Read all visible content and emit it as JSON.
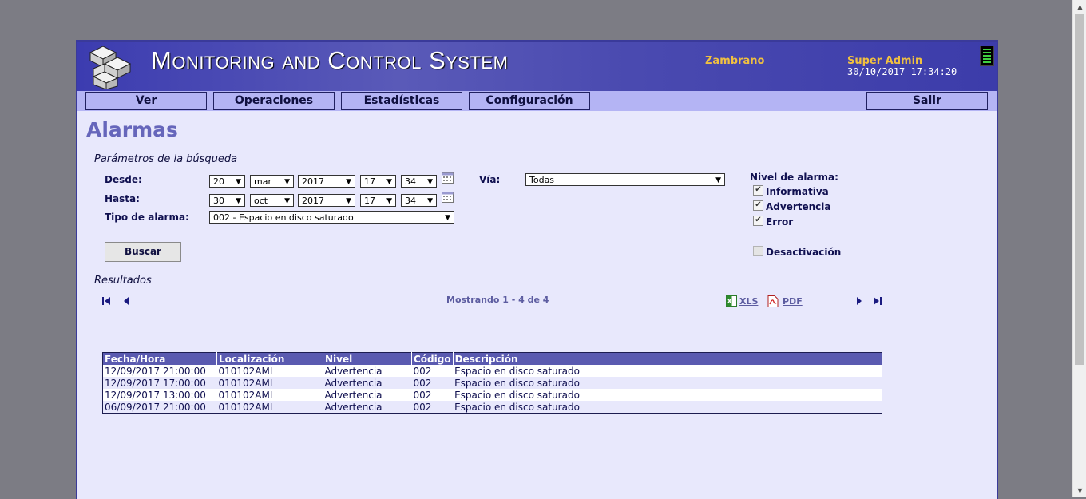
{
  "header": {
    "app_title": "Monitoring and Control System",
    "server_name": "Zambrano",
    "user_role": "Super Admin",
    "datetime": "30/10/2017 17:34:20"
  },
  "nav": {
    "items": [
      "Ver",
      "Operaciones",
      "Estadísticas",
      "Configuración"
    ],
    "logout": "Salir"
  },
  "page": {
    "title": "Alarmas"
  },
  "search": {
    "section_title": "Parámetros de la búsqueda",
    "from_label": "Desde:",
    "to_label": "Hasta:",
    "type_label": "Tipo de alarma:",
    "from": {
      "day": "20",
      "month": "mar",
      "year": "2017",
      "hour": "17",
      "minute": "34"
    },
    "to": {
      "day": "30",
      "month": "oct",
      "year": "2017",
      "hour": "17",
      "minute": "34"
    },
    "alarm_type": "002 - Espacio en disco saturado",
    "via_label": "Vía:",
    "via_value": "Todas",
    "level_label": "Nivel de alarma:",
    "levels": [
      {
        "label": "Informativa",
        "checked": true
      },
      {
        "label": "Advertencia",
        "checked": true
      },
      {
        "label": "Error",
        "checked": true
      }
    ],
    "deactivation_label": "Desactivación",
    "deactivation_checked": false,
    "search_button": "Buscar"
  },
  "results": {
    "section_title": "Resultados",
    "showing": "Mostrando 1 - 4 de 4",
    "xls_label": "XLS",
    "pdf_label": "PDF",
    "columns": [
      "Fecha/Hora",
      "Localización",
      "Nivel",
      "Código",
      "Descripción"
    ],
    "rows": [
      [
        "12/09/2017 21:00:00",
        "010102AMI",
        "Advertencia",
        "002",
        "Espacio en disco saturado"
      ],
      [
        "12/09/2017 17:00:00",
        "010102AMI",
        "Advertencia",
        "002",
        "Espacio en disco saturado"
      ],
      [
        "12/09/2017 13:00:00",
        "010102AMI",
        "Advertencia",
        "002",
        "Espacio en disco saturado"
      ],
      [
        "06/09/2017 21:00:00",
        "010102AMI",
        "Advertencia",
        "002",
        "Espacio en disco saturado"
      ]
    ]
  },
  "colors": {
    "header_bg": "#4a4ab0",
    "nav_bg": "#b4b4f4",
    "page_bg": "#e8e8fc",
    "title_color": "#6666bb",
    "accent_yellow": "#f0c040",
    "table_header_bg": "#5a5ab0"
  },
  "icons": {
    "logo": "stacked-cubes-icon",
    "calendar": "calendar-icon",
    "first": "first-page-icon",
    "prev": "prev-page-icon",
    "next": "next-page-icon",
    "last": "last-page-icon",
    "xls": "excel-icon",
    "pdf": "pdf-icon"
  }
}
